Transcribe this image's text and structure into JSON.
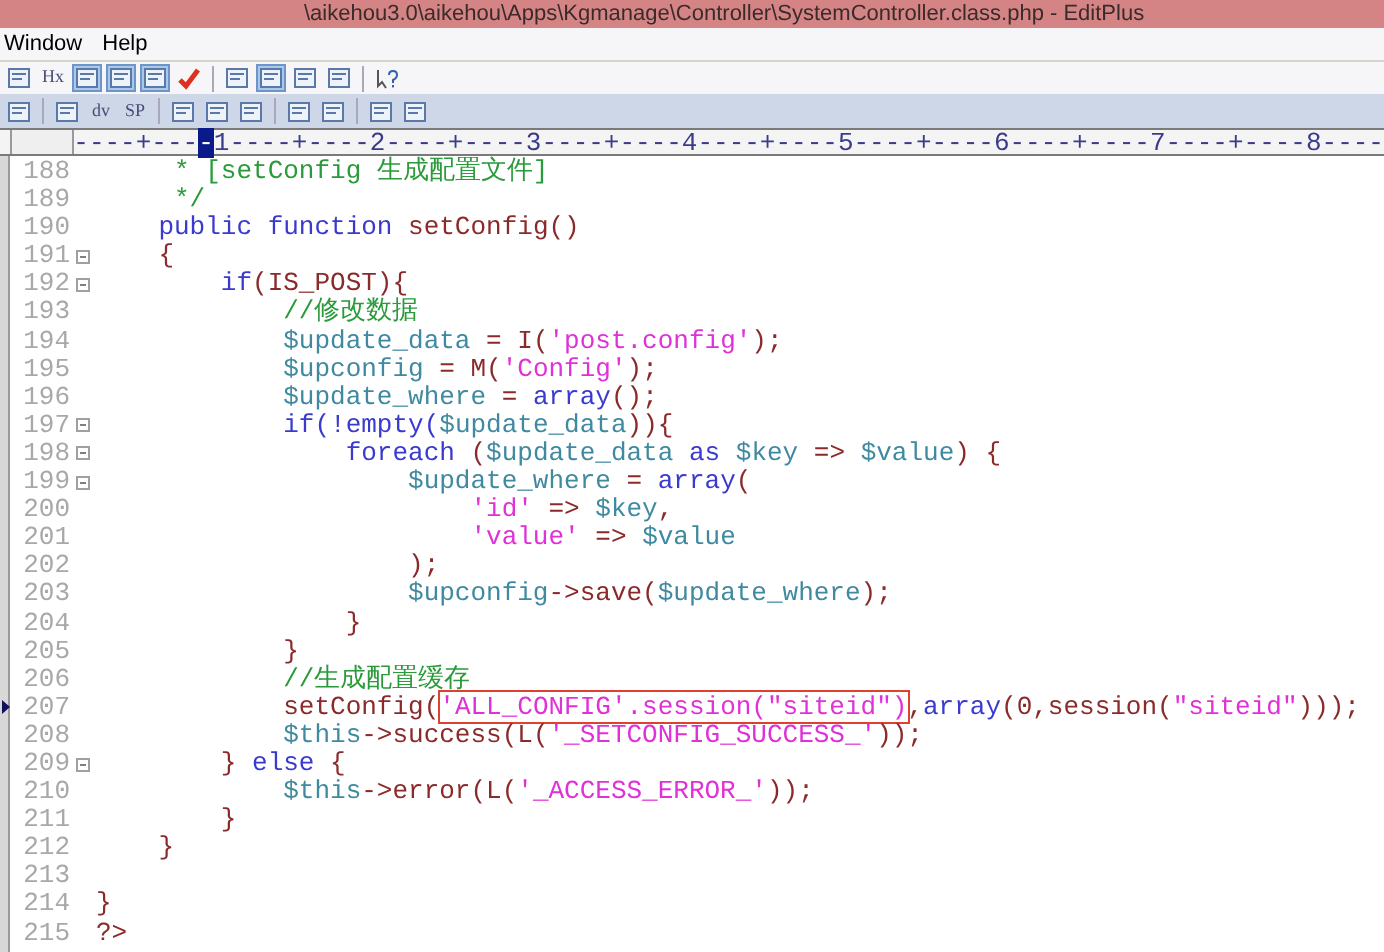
{
  "window": {
    "title": "\\aikehou3.0\\aikehou\\Apps\\Kgmanage\\Controller\\SystemController.class.php - EditPlus"
  },
  "menu": [
    "Window",
    "Help"
  ],
  "toolbar_1": [
    {
      "kind": "icon",
      "pressed": false
    },
    {
      "kind": "text",
      "label": "Hx",
      "pressed": false
    },
    {
      "kind": "icon",
      "pressed": true
    },
    {
      "kind": "icon",
      "pressed": true
    },
    {
      "kind": "icon",
      "pressed": true
    },
    {
      "kind": "check",
      "pressed": false
    },
    {
      "kind": "sep"
    },
    {
      "kind": "icon",
      "pressed": false
    },
    {
      "kind": "icon",
      "pressed": true
    },
    {
      "kind": "icon",
      "pressed": false
    },
    {
      "kind": "icon",
      "pressed": false
    },
    {
      "kind": "sep"
    },
    {
      "kind": "help",
      "pressed": false
    }
  ],
  "toolbar_2": [
    {
      "kind": "icon",
      "pressed": false
    },
    {
      "kind": "sep"
    },
    {
      "kind": "icon",
      "pressed": false
    },
    {
      "kind": "text",
      "label": "dv",
      "pressed": false
    },
    {
      "kind": "text",
      "label": "SP",
      "pressed": false
    },
    {
      "kind": "sep"
    },
    {
      "kind": "icon",
      "pressed": false
    },
    {
      "kind": "icon",
      "pressed": false
    },
    {
      "kind": "icon",
      "pressed": false
    },
    {
      "kind": "sep"
    },
    {
      "kind": "icon",
      "pressed": false
    },
    {
      "kind": "icon",
      "pressed": false
    },
    {
      "kind": "sep"
    },
    {
      "kind": "icon",
      "pressed": false
    },
    {
      "kind": "icon",
      "pressed": false
    }
  ],
  "ruler": {
    "before": "----+---",
    "cursor": "-",
    "after": "1----+----2----+----3----+----4----+----5----+----6----+----7----+----8----"
  },
  "lines": [
    {
      "number": "188",
      "foldable": false,
      "current": false,
      "tokens": [
        {
          "kind": "comment",
          "text": "     * [setConfig 生成配置文件]"
        }
      ]
    },
    {
      "number": "189",
      "foldable": false,
      "current": false,
      "tokens": [
        {
          "kind": "comment",
          "text": "     */"
        }
      ]
    },
    {
      "number": "190",
      "foldable": false,
      "current": false,
      "tokens": [
        {
          "kind": "keyword",
          "text": "    public function "
        },
        {
          "kind": "plain",
          "text": "setConfig()"
        }
      ]
    },
    {
      "number": "191",
      "foldable": true,
      "current": false,
      "tokens": [
        {
          "kind": "plain",
          "text": "    {"
        }
      ]
    },
    {
      "number": "192",
      "foldable": true,
      "current": false,
      "tokens": [
        {
          "kind": "keyword",
          "text": "        if"
        },
        {
          "kind": "plain",
          "text": "(IS_POST){"
        }
      ]
    },
    {
      "number": "193",
      "foldable": false,
      "current": false,
      "tokens": [
        {
          "kind": "comment",
          "text": "            //修改数据"
        }
      ]
    },
    {
      "number": "194",
      "foldable": false,
      "current": false,
      "tokens": [
        {
          "kind": "variable",
          "text": "            $update_data"
        },
        {
          "kind": "plain",
          "text": " = I("
        },
        {
          "kind": "string",
          "text": "'post.config'"
        },
        {
          "kind": "plain",
          "text": ");"
        }
      ]
    },
    {
      "number": "195",
      "foldable": false,
      "current": false,
      "tokens": [
        {
          "kind": "variable",
          "text": "            $upconfig"
        },
        {
          "kind": "plain",
          "text": " = M("
        },
        {
          "kind": "string",
          "text": "'Config'"
        },
        {
          "kind": "plain",
          "text": ");"
        }
      ]
    },
    {
      "number": "196",
      "foldable": false,
      "current": false,
      "tokens": [
        {
          "kind": "variable",
          "text": "            $update_where"
        },
        {
          "kind": "plain",
          "text": " = "
        },
        {
          "kind": "keyword",
          "text": "array"
        },
        {
          "kind": "plain",
          "text": "();"
        }
      ]
    },
    {
      "number": "197",
      "foldable": true,
      "current": false,
      "tokens": [
        {
          "kind": "keyword",
          "text": "            if(!empty("
        },
        {
          "kind": "variable",
          "text": "$update_data"
        },
        {
          "kind": "plain",
          "text": ")){"
        }
      ]
    },
    {
      "number": "198",
      "foldable": true,
      "current": false,
      "tokens": [
        {
          "kind": "keyword",
          "text": "                foreach "
        },
        {
          "kind": "plain",
          "text": "("
        },
        {
          "kind": "variable",
          "text": "$update_data"
        },
        {
          "kind": "keyword",
          "text": " as "
        },
        {
          "kind": "variable",
          "text": "$key"
        },
        {
          "kind": "plain",
          "text": " => "
        },
        {
          "kind": "variable",
          "text": "$value"
        },
        {
          "kind": "plain",
          "text": ") {"
        }
      ]
    },
    {
      "number": "199",
      "foldable": true,
      "current": false,
      "tokens": [
        {
          "kind": "variable",
          "text": "                    $update_where"
        },
        {
          "kind": "plain",
          "text": " = "
        },
        {
          "kind": "keyword",
          "text": "array"
        },
        {
          "kind": "plain",
          "text": "("
        }
      ]
    },
    {
      "number": "200",
      "foldable": false,
      "current": false,
      "tokens": [
        {
          "kind": "string",
          "text": "                        'id'"
        },
        {
          "kind": "plain",
          "text": " => "
        },
        {
          "kind": "variable",
          "text": "$key"
        },
        {
          "kind": "plain",
          "text": ","
        }
      ]
    },
    {
      "number": "201",
      "foldable": false,
      "current": false,
      "tokens": [
        {
          "kind": "string",
          "text": "                        'value'"
        },
        {
          "kind": "plain",
          "text": " => "
        },
        {
          "kind": "variable",
          "text": "$value"
        }
      ]
    },
    {
      "number": "202",
      "foldable": false,
      "current": false,
      "tokens": [
        {
          "kind": "plain",
          "text": "                    );"
        }
      ]
    },
    {
      "number": "203",
      "foldable": false,
      "current": false,
      "tokens": [
        {
          "kind": "variable",
          "text": "                    $upconfig"
        },
        {
          "kind": "plain",
          "text": "->save("
        },
        {
          "kind": "variable",
          "text": "$update_where"
        },
        {
          "kind": "plain",
          "text": ");"
        }
      ]
    },
    {
      "number": "204",
      "foldable": false,
      "current": false,
      "tokens": [
        {
          "kind": "plain",
          "text": "                }"
        }
      ]
    },
    {
      "number": "205",
      "foldable": false,
      "current": false,
      "tokens": [
        {
          "kind": "plain",
          "text": "            }"
        }
      ]
    },
    {
      "number": "206",
      "foldable": false,
      "current": false,
      "tokens": [
        {
          "kind": "comment",
          "text": "            //生成配置缓存"
        }
      ]
    },
    {
      "number": "207",
      "foldable": false,
      "current": true,
      "tokens": [
        {
          "kind": "plain",
          "text": "            setConfig("
        },
        {
          "kind": "boxed",
          "text": "'ALL_CONFIG'.session(\"siteid\")"
        },
        {
          "kind": "plain",
          "text": ","
        },
        {
          "kind": "keyword",
          "text": "array"
        },
        {
          "kind": "plain",
          "text": "(0,session("
        },
        {
          "kind": "string",
          "text": "\"siteid\""
        },
        {
          "kind": "plain",
          "text": ")));"
        }
      ]
    },
    {
      "number": "208",
      "foldable": false,
      "current": false,
      "tokens": [
        {
          "kind": "variable",
          "text": "            $this"
        },
        {
          "kind": "plain",
          "text": "->success(L("
        },
        {
          "kind": "string",
          "text": "'_SETCONFIG_SUCCESS_'"
        },
        {
          "kind": "plain",
          "text": "));"
        }
      ]
    },
    {
      "number": "209",
      "foldable": true,
      "current": false,
      "tokens": [
        {
          "kind": "plain",
          "text": "        } "
        },
        {
          "kind": "keyword",
          "text": "else"
        },
        {
          "kind": "plain",
          "text": " {"
        }
      ]
    },
    {
      "number": "210",
      "foldable": false,
      "current": false,
      "tokens": [
        {
          "kind": "variable",
          "text": "            $this"
        },
        {
          "kind": "plain",
          "text": "->error(L("
        },
        {
          "kind": "string",
          "text": "'_ACCESS_ERROR_'"
        },
        {
          "kind": "plain",
          "text": "));"
        }
      ]
    },
    {
      "number": "211",
      "foldable": false,
      "current": false,
      "tokens": [
        {
          "kind": "plain",
          "text": "        }"
        }
      ]
    },
    {
      "number": "212",
      "foldable": false,
      "current": false,
      "tokens": [
        {
          "kind": "plain",
          "text": "    }"
        }
      ]
    },
    {
      "number": "213",
      "foldable": false,
      "current": false
    },
    {
      "number": "214",
      "foldable": false,
      "current": false,
      "tokens": [
        {
          "kind": "plain",
          "text": "}"
        }
      ]
    },
    {
      "number": "215",
      "foldable": false,
      "current": false,
      "tokens": [
        {
          "kind": "plain",
          "text": "?>"
        }
      ]
    }
  ]
}
